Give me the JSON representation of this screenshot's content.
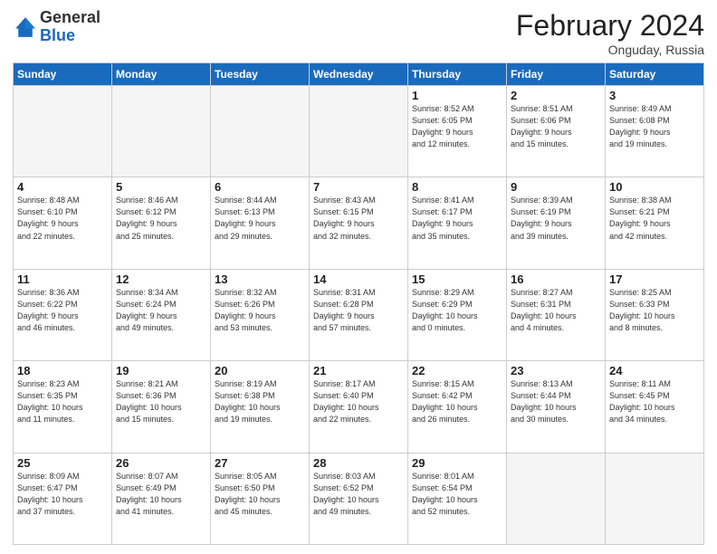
{
  "header": {
    "logo_general": "General",
    "logo_blue": "Blue",
    "month_title": "February 2024",
    "subtitle": "Onguday, Russia"
  },
  "weekdays": [
    "Sunday",
    "Monday",
    "Tuesday",
    "Wednesday",
    "Thursday",
    "Friday",
    "Saturday"
  ],
  "weeks": [
    [
      {
        "day": "",
        "info": ""
      },
      {
        "day": "",
        "info": ""
      },
      {
        "day": "",
        "info": ""
      },
      {
        "day": "",
        "info": ""
      },
      {
        "day": "1",
        "info": "Sunrise: 8:52 AM\nSunset: 6:05 PM\nDaylight: 9 hours\nand 12 minutes."
      },
      {
        "day": "2",
        "info": "Sunrise: 8:51 AM\nSunset: 6:06 PM\nDaylight: 9 hours\nand 15 minutes."
      },
      {
        "day": "3",
        "info": "Sunrise: 8:49 AM\nSunset: 6:08 PM\nDaylight: 9 hours\nand 19 minutes."
      }
    ],
    [
      {
        "day": "4",
        "info": "Sunrise: 8:48 AM\nSunset: 6:10 PM\nDaylight: 9 hours\nand 22 minutes."
      },
      {
        "day": "5",
        "info": "Sunrise: 8:46 AM\nSunset: 6:12 PM\nDaylight: 9 hours\nand 25 minutes."
      },
      {
        "day": "6",
        "info": "Sunrise: 8:44 AM\nSunset: 6:13 PM\nDaylight: 9 hours\nand 29 minutes."
      },
      {
        "day": "7",
        "info": "Sunrise: 8:43 AM\nSunset: 6:15 PM\nDaylight: 9 hours\nand 32 minutes."
      },
      {
        "day": "8",
        "info": "Sunrise: 8:41 AM\nSunset: 6:17 PM\nDaylight: 9 hours\nand 35 minutes."
      },
      {
        "day": "9",
        "info": "Sunrise: 8:39 AM\nSunset: 6:19 PM\nDaylight: 9 hours\nand 39 minutes."
      },
      {
        "day": "10",
        "info": "Sunrise: 8:38 AM\nSunset: 6:21 PM\nDaylight: 9 hours\nand 42 minutes."
      }
    ],
    [
      {
        "day": "11",
        "info": "Sunrise: 8:36 AM\nSunset: 6:22 PM\nDaylight: 9 hours\nand 46 minutes."
      },
      {
        "day": "12",
        "info": "Sunrise: 8:34 AM\nSunset: 6:24 PM\nDaylight: 9 hours\nand 49 minutes."
      },
      {
        "day": "13",
        "info": "Sunrise: 8:32 AM\nSunset: 6:26 PM\nDaylight: 9 hours\nand 53 minutes."
      },
      {
        "day": "14",
        "info": "Sunrise: 8:31 AM\nSunset: 6:28 PM\nDaylight: 9 hours\nand 57 minutes."
      },
      {
        "day": "15",
        "info": "Sunrise: 8:29 AM\nSunset: 6:29 PM\nDaylight: 10 hours\nand 0 minutes."
      },
      {
        "day": "16",
        "info": "Sunrise: 8:27 AM\nSunset: 6:31 PM\nDaylight: 10 hours\nand 4 minutes."
      },
      {
        "day": "17",
        "info": "Sunrise: 8:25 AM\nSunset: 6:33 PM\nDaylight: 10 hours\nand 8 minutes."
      }
    ],
    [
      {
        "day": "18",
        "info": "Sunrise: 8:23 AM\nSunset: 6:35 PM\nDaylight: 10 hours\nand 11 minutes."
      },
      {
        "day": "19",
        "info": "Sunrise: 8:21 AM\nSunset: 6:36 PM\nDaylight: 10 hours\nand 15 minutes."
      },
      {
        "day": "20",
        "info": "Sunrise: 8:19 AM\nSunset: 6:38 PM\nDaylight: 10 hours\nand 19 minutes."
      },
      {
        "day": "21",
        "info": "Sunrise: 8:17 AM\nSunset: 6:40 PM\nDaylight: 10 hours\nand 22 minutes."
      },
      {
        "day": "22",
        "info": "Sunrise: 8:15 AM\nSunset: 6:42 PM\nDaylight: 10 hours\nand 26 minutes."
      },
      {
        "day": "23",
        "info": "Sunrise: 8:13 AM\nSunset: 6:44 PM\nDaylight: 10 hours\nand 30 minutes."
      },
      {
        "day": "24",
        "info": "Sunrise: 8:11 AM\nSunset: 6:45 PM\nDaylight: 10 hours\nand 34 minutes."
      }
    ],
    [
      {
        "day": "25",
        "info": "Sunrise: 8:09 AM\nSunset: 6:47 PM\nDaylight: 10 hours\nand 37 minutes."
      },
      {
        "day": "26",
        "info": "Sunrise: 8:07 AM\nSunset: 6:49 PM\nDaylight: 10 hours\nand 41 minutes."
      },
      {
        "day": "27",
        "info": "Sunrise: 8:05 AM\nSunset: 6:50 PM\nDaylight: 10 hours\nand 45 minutes."
      },
      {
        "day": "28",
        "info": "Sunrise: 8:03 AM\nSunset: 6:52 PM\nDaylight: 10 hours\nand 49 minutes."
      },
      {
        "day": "29",
        "info": "Sunrise: 8:01 AM\nSunset: 6:54 PM\nDaylight: 10 hours\nand 52 minutes."
      },
      {
        "day": "",
        "info": ""
      },
      {
        "day": "",
        "info": ""
      }
    ]
  ]
}
